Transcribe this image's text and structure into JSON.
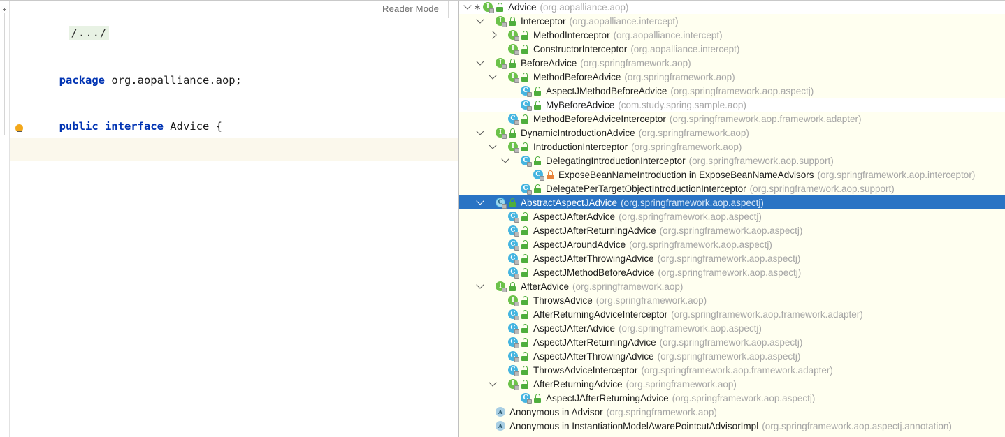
{
  "editor": {
    "fold_placeholder": "/.../",
    "reader_mode_label": "Reader Mode",
    "lines": [
      {
        "kw": "package",
        "rest": " org.aopalliance.aop;"
      },
      {
        "kw": "public interface",
        "rest": " Advice {"
      },
      {
        "kw": "",
        "rest": "}"
      }
    ],
    "line1_keyword": "package",
    "line1_rest": " org.aopalliance.aop;",
    "line2_keyword": "public interface",
    "line2_rest": " Advice {",
    "line3_text": "}",
    "bulb_icon": "intention-bulb-icon"
  },
  "tree": {
    "selected_index": 16,
    "selection_color": "#2a74c4",
    "background_color": "#fffff0",
    "rows": [
      {
        "depth": 0,
        "chev": "down",
        "star": true,
        "icon": "interface",
        "vis": "public",
        "name": "Advice",
        "pkg": "(org.aopalliance.aop)",
        "bg": "white"
      },
      {
        "depth": 1,
        "chev": "down",
        "star": false,
        "icon": "interface",
        "vis": "public",
        "name": "Interceptor",
        "pkg": "(org.aopalliance.intercept)",
        "bg": "cream"
      },
      {
        "depth": 2,
        "chev": "right",
        "star": false,
        "icon": "interface",
        "vis": "public",
        "name": "MethodInterceptor",
        "pkg": "(org.aopalliance.intercept)",
        "bg": "cream"
      },
      {
        "depth": 2,
        "chev": "none",
        "star": false,
        "icon": "interface",
        "vis": "public",
        "name": "ConstructorInterceptor",
        "pkg": "(org.aopalliance.intercept)",
        "bg": "cream"
      },
      {
        "depth": 1,
        "chev": "down",
        "star": false,
        "icon": "interface",
        "vis": "public",
        "name": "BeforeAdvice",
        "pkg": "(org.springframework.aop)",
        "bg": "cream"
      },
      {
        "depth": 2,
        "chev": "down",
        "star": false,
        "icon": "interface",
        "vis": "public",
        "name": "MethodBeforeAdvice",
        "pkg": "(org.springframework.aop)",
        "bg": "cream"
      },
      {
        "depth": 3,
        "chev": "none",
        "star": false,
        "icon": "class",
        "vis": "public",
        "name": "AspectJMethodBeforeAdvice",
        "pkg": "(org.springframework.aop.aspectj)",
        "bg": "cream"
      },
      {
        "depth": 3,
        "chev": "none",
        "star": false,
        "icon": "class",
        "vis": "public",
        "name": "MyBeforeAdvice",
        "pkg": "(com.study.spring.sample.aop)",
        "bg": "white"
      },
      {
        "depth": 2,
        "chev": "none",
        "star": false,
        "icon": "class",
        "vis": "public",
        "name": "MethodBeforeAdviceInterceptor",
        "pkg": "(org.springframework.aop.framework.adapter)",
        "bg": "cream"
      },
      {
        "depth": 1,
        "chev": "down",
        "star": false,
        "icon": "interface",
        "vis": "public",
        "name": "DynamicIntroductionAdvice",
        "pkg": "(org.springframework.aop)",
        "bg": "cream"
      },
      {
        "depth": 2,
        "chev": "down",
        "star": false,
        "icon": "interface",
        "vis": "public",
        "name": "IntroductionInterceptor",
        "pkg": "(org.springframework.aop)",
        "bg": "cream"
      },
      {
        "depth": 3,
        "chev": "down",
        "star": false,
        "icon": "class",
        "vis": "public",
        "name": "DelegatingIntroductionInterceptor",
        "pkg": "(org.springframework.aop.support)",
        "bg": "cream"
      },
      {
        "depth": 4,
        "chev": "none",
        "star": false,
        "icon": "class",
        "vis": "private",
        "name": "ExposeBeanNameIntroduction in ExposeBeanNameAdvisors",
        "pkg": "(org.springframework.aop.interceptor)",
        "bg": "cream"
      },
      {
        "depth": 3,
        "chev": "none",
        "star": false,
        "icon": "class",
        "vis": "public",
        "name": "DelegatePerTargetObjectIntroductionInterceptor",
        "pkg": "(org.springframework.aop.support)",
        "bg": "cream"
      },
      {
        "depth": 1,
        "chev": "down",
        "star": false,
        "icon": "abstract",
        "vis": "public",
        "name": "AbstractAspectJAdvice",
        "pkg": "(org.springframework.aop.aspectj)",
        "bg": "selected"
      },
      {
        "depth": 2,
        "chev": "none",
        "star": false,
        "icon": "class",
        "vis": "public",
        "name": "AspectJAfterAdvice",
        "pkg": "(org.springframework.aop.aspectj)",
        "bg": "cream"
      },
      {
        "depth": 2,
        "chev": "none",
        "star": false,
        "icon": "class",
        "vis": "public",
        "name": "AspectJAfterReturningAdvice",
        "pkg": "(org.springframework.aop.aspectj)",
        "bg": "cream"
      },
      {
        "depth": 2,
        "chev": "none",
        "star": false,
        "icon": "class",
        "vis": "public",
        "name": "AspectJAroundAdvice",
        "pkg": "(org.springframework.aop.aspectj)",
        "bg": "cream"
      },
      {
        "depth": 2,
        "chev": "none",
        "star": false,
        "icon": "class",
        "vis": "public",
        "name": "AspectJAfterThrowingAdvice",
        "pkg": "(org.springframework.aop.aspectj)",
        "bg": "cream"
      },
      {
        "depth": 2,
        "chev": "none",
        "star": false,
        "icon": "class",
        "vis": "public",
        "name": "AspectJMethodBeforeAdvice",
        "pkg": "(org.springframework.aop.aspectj)",
        "bg": "cream"
      },
      {
        "depth": 1,
        "chev": "down",
        "star": false,
        "icon": "interface",
        "vis": "public",
        "name": "AfterAdvice",
        "pkg": "(org.springframework.aop)",
        "bg": "cream"
      },
      {
        "depth": 2,
        "chev": "none",
        "star": false,
        "icon": "interface",
        "vis": "public",
        "name": "ThrowsAdvice",
        "pkg": "(org.springframework.aop)",
        "bg": "cream"
      },
      {
        "depth": 2,
        "chev": "none",
        "star": false,
        "icon": "class",
        "vis": "public",
        "name": "AfterReturningAdviceInterceptor",
        "pkg": "(org.springframework.aop.framework.adapter)",
        "bg": "cream"
      },
      {
        "depth": 2,
        "chev": "none",
        "star": false,
        "icon": "class",
        "vis": "public",
        "name": "AspectJAfterAdvice",
        "pkg": "(org.springframework.aop.aspectj)",
        "bg": "cream"
      },
      {
        "depth": 2,
        "chev": "none",
        "star": false,
        "icon": "class",
        "vis": "public",
        "name": "AspectJAfterReturningAdvice",
        "pkg": "(org.springframework.aop.aspectj)",
        "bg": "cream"
      },
      {
        "depth": 2,
        "chev": "none",
        "star": false,
        "icon": "class",
        "vis": "public",
        "name": "AspectJAfterThrowingAdvice",
        "pkg": "(org.springframework.aop.aspectj)",
        "bg": "cream"
      },
      {
        "depth": 2,
        "chev": "none",
        "star": false,
        "icon": "class",
        "vis": "public",
        "name": "ThrowsAdviceInterceptor",
        "pkg": "(org.springframework.aop.framework.adapter)",
        "bg": "cream"
      },
      {
        "depth": 2,
        "chev": "down",
        "star": false,
        "icon": "interface",
        "vis": "public",
        "name": "AfterReturningAdvice",
        "pkg": "(org.springframework.aop)",
        "bg": "cream"
      },
      {
        "depth": 3,
        "chev": "none",
        "star": false,
        "icon": "class",
        "vis": "public",
        "name": "AspectJAfterReturningAdvice",
        "pkg": "(org.springframework.aop.aspectj)",
        "bg": "cream"
      },
      {
        "depth": 1,
        "chev": "none",
        "star": false,
        "icon": "anonymous",
        "vis": "none",
        "name": "Anonymous in Advisor",
        "pkg": "(org.springframework.aop)",
        "bg": "cream"
      },
      {
        "depth": 1,
        "chev": "none",
        "star": false,
        "icon": "anonymous",
        "vis": "none",
        "name": "Anonymous in InstantiationModelAwarePointcutAdvisorImpl",
        "pkg": "(org.springframework.aop.aspectj.annotation)",
        "bg": "cream"
      }
    ]
  }
}
